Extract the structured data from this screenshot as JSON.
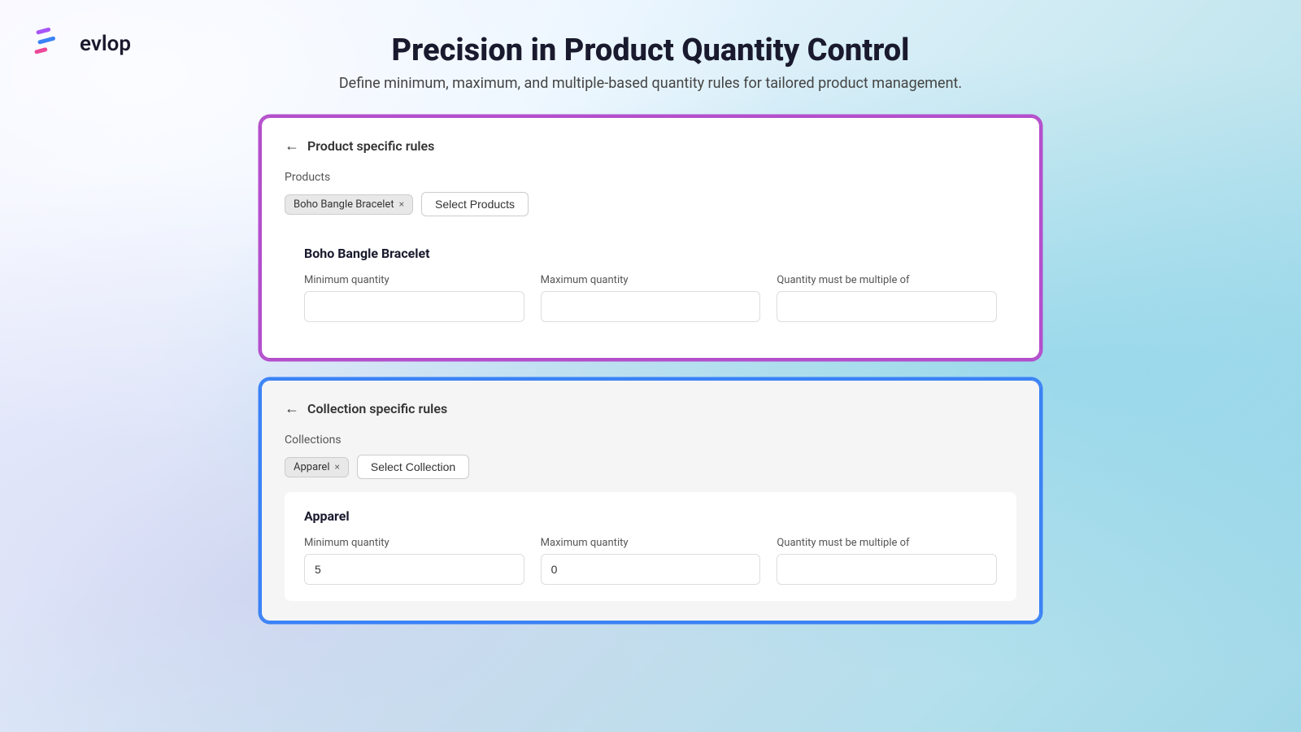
{
  "logo": {
    "text": "evlop",
    "icon_label": "evlop-logo"
  },
  "header": {
    "title": "Precision in Product Quantity Control",
    "subtitle": "Define minimum, maximum, and multiple-based quantity rules for tailored product management."
  },
  "product_card": {
    "back_label": "←",
    "title": "Product specific rules",
    "section_label": "Products",
    "tag_label": "Boho Bangle Bracelet",
    "tag_close": "×",
    "select_btn": "Select Products",
    "inner_title": "Boho Bangle Bracelet",
    "min_label": "Minimum quantity",
    "max_label": "Maximum quantity",
    "multiple_label": "Quantity must be multiple of",
    "min_value": "",
    "max_value": "",
    "multiple_value": ""
  },
  "collection_card": {
    "back_label": "←",
    "title": "Collection specific rules",
    "section_label": "Collections",
    "tag_label": "Apparel",
    "tag_close": "×",
    "select_btn": "Select Collection",
    "inner_title": "Apparel",
    "min_label": "Minimum quantity",
    "max_label": "Maximum quantity",
    "multiple_label": "Quantity must be multiple of",
    "min_value": "5",
    "max_value": "0",
    "multiple_value": ""
  }
}
